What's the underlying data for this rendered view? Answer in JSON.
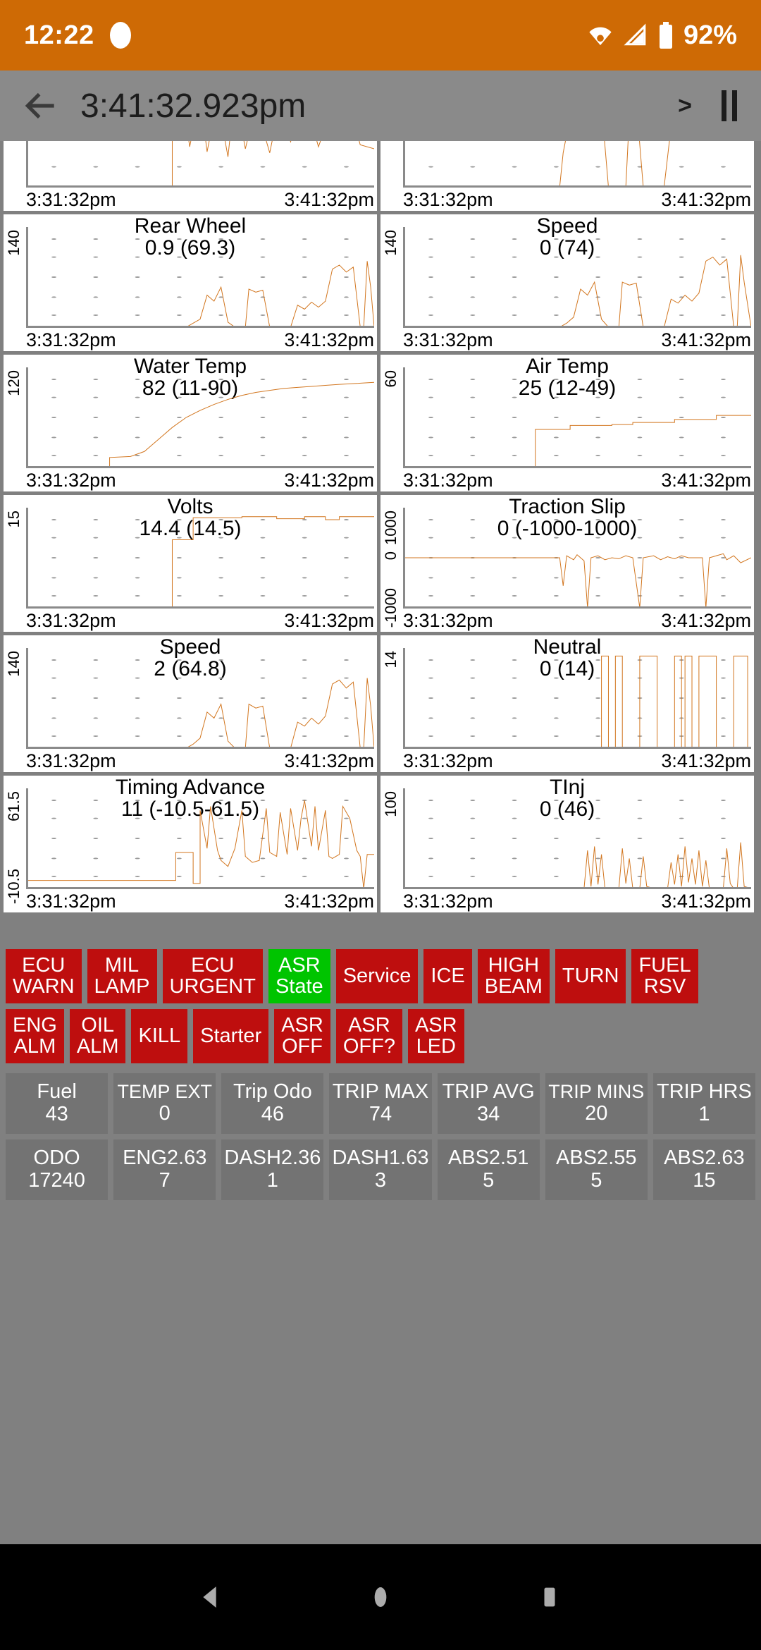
{
  "status_bar": {
    "clock": "12:22",
    "battery_percent": "92%",
    "icons": [
      "recording-dot-icon",
      "wifi-icon",
      "cell-signal-icon",
      "battery-icon"
    ]
  },
  "toolbar": {
    "back_icon": "back-arrow-icon",
    "title": "3:41:32.923pm",
    "next_label": ">",
    "pause_icon": "pause-icon"
  },
  "charts": {
    "x_start": "3:31:32pm",
    "x_end": "3:41:32pm",
    "line_color": "#D2761F"
  },
  "chart_data": [
    {
      "type": "line",
      "title": "",
      "value_label": "",
      "ylabel": "",
      "ytick_top": "",
      "xlabel_left": "3:31:32pm",
      "xlabel_right": "3:41:32pm",
      "note": "clipped row above Rear Wheel — spiky square-wave trace",
      "x": [
        0,
        34,
        36,
        40,
        44,
        48,
        52,
        56,
        60,
        64,
        68,
        72,
        76,
        80,
        84,
        88,
        92,
        96,
        100
      ],
      "values": [
        0,
        0,
        82,
        55,
        88,
        40,
        90,
        30,
        72,
        85,
        38,
        90,
        35,
        80,
        60,
        88,
        45,
        78,
        52
      ]
    },
    {
      "type": "line",
      "title": "Rear Wheel",
      "value_label": "0.9 (69.3)",
      "ylabel": "140",
      "ytick_top": "140",
      "ylim": [
        0,
        140
      ],
      "xlabel_left": "3:31:32pm",
      "xlabel_right": "3:41:32pm",
      "x": [
        0,
        48,
        52,
        55,
        58,
        60,
        63,
        66,
        69,
        72,
        74,
        78,
        82,
        86,
        90,
        94,
        97,
        100
      ],
      "values": [
        0,
        0,
        6,
        40,
        30,
        44,
        8,
        0,
        42,
        40,
        0,
        18,
        26,
        22,
        60,
        64,
        6,
        58
      ]
    },
    {
      "type": "line",
      "title": "Speed",
      "value_label": "0 (74)",
      "ylabel": "140",
      "ytick_top": "140",
      "ylim": [
        0,
        140
      ],
      "xlabel_left": "3:31:32pm",
      "xlabel_right": "3:41:32pm",
      "x": [
        0,
        47,
        51,
        54,
        57,
        60,
        63,
        66,
        69,
        72,
        76,
        80,
        84,
        88,
        92,
        96,
        100
      ],
      "values": [
        0,
        0,
        8,
        48,
        36,
        52,
        6,
        0,
        50,
        46,
        0,
        22,
        30,
        26,
        66,
        10,
        62
      ]
    },
    {
      "type": "line",
      "title": "Water Temp",
      "value_label": "82 (11-90)",
      "ylabel": "120",
      "ytick_top": "120",
      "ylim": [
        0,
        120
      ],
      "xlabel_left": "3:31:32pm",
      "xlabel_right": "3:41:32pm",
      "x": [
        0,
        24,
        25,
        30,
        36,
        42,
        48,
        54,
        60,
        66,
        72,
        78,
        84,
        90,
        95,
        100
      ],
      "values": [
        0,
        0,
        11,
        12,
        22,
        36,
        48,
        58,
        64,
        68,
        71,
        73,
        75,
        76,
        77,
        78
      ]
    },
    {
      "type": "line",
      "title": "Air Temp",
      "value_label": "25 (12-49)",
      "ylabel": "60",
      "ytick_top": "60",
      "ylim": [
        0,
        60
      ],
      "xlabel_left": "3:31:32pm",
      "xlabel_right": "3:41:32pm",
      "x": [
        0,
        38,
        39,
        46,
        54,
        62,
        70,
        78,
        86,
        94,
        100
      ],
      "values": [
        0,
        0,
        23,
        25,
        25,
        26,
        26,
        27,
        28,
        30,
        30
      ]
    },
    {
      "type": "line",
      "title": "Volts",
      "value_label": "14.4 (14.5)",
      "ylabel": "15",
      "ytick_top": "15",
      "ylim": [
        0,
        15
      ],
      "xlabel_left": "3:31:32pm",
      "xlabel_right": "3:41:32pm",
      "x": [
        0,
        42,
        43,
        48,
        55,
        62,
        70,
        78,
        86,
        94,
        100
      ],
      "values": [
        0,
        0,
        11.8,
        14.4,
        14.5,
        14.5,
        14.5,
        14.6,
        14.4,
        14.5,
        14.5
      ]
    },
    {
      "type": "line",
      "title": "Traction Slip",
      "value_label": "0 (-1000-1000)",
      "ylabel": "1000 / 0 / -1000",
      "ytick_top": "1000",
      "ytick_mid": "0",
      "ytick_low": "-1000",
      "ylim": [
        -1000,
        1000
      ],
      "xlabel_left": "3:31:32pm",
      "xlabel_right": "3:41:32pm",
      "x": [
        0,
        46,
        48,
        50,
        52,
        56,
        60,
        64,
        68,
        72,
        76,
        80,
        86,
        92,
        96,
        100
      ],
      "values": [
        0,
        0,
        -620,
        40,
        -900,
        30,
        -1000,
        20,
        -40,
        30,
        20,
        -30,
        -1000,
        60,
        -80,
        0
      ]
    },
    {
      "type": "line",
      "title": "Speed",
      "value_label": "2 (64.8)",
      "ylabel": "140",
      "ytick_top": "140",
      "ylim": [
        0,
        140
      ],
      "xlabel_left": "3:31:32pm",
      "xlabel_right": "3:41:32pm",
      "x": [
        0,
        48,
        52,
        55,
        58,
        61,
        64,
        67,
        70,
        73,
        78,
        82,
        86,
        90,
        94,
        97,
        100
      ],
      "values": [
        0,
        0,
        8,
        44,
        34,
        50,
        6,
        0,
        46,
        44,
        0,
        20,
        28,
        24,
        62,
        8,
        58
      ]
    },
    {
      "type": "line",
      "title": "Neutral",
      "value_label": "0 (14)",
      "ylabel": "14",
      "ytick_top": "14",
      "ylim": [
        0,
        14
      ],
      "xlabel_left": "3:31:32pm",
      "xlabel_right": "3:41:32pm",
      "x": [
        0,
        60,
        61,
        63,
        64,
        66,
        70,
        71,
        76,
        77,
        80,
        81,
        83,
        84,
        88,
        89,
        95,
        96,
        100
      ],
      "values": [
        0,
        0,
        14,
        14,
        0,
        0,
        14,
        0,
        14,
        0,
        14,
        0,
        14,
        0,
        14,
        0,
        14,
        0,
        0
      ]
    },
    {
      "type": "line",
      "title": "Timing Advance",
      "value_label": "11 (-10.5-61.5)",
      "ylabel": "61.5 / -10.5",
      "ytick_top": "61.5",
      "ytick_low": "-10.5",
      "ylim": [
        -10.5,
        61.5
      ],
      "xlabel_left": "3:31:32pm",
      "xlabel_right": "3:41:32pm",
      "x": [
        0,
        42,
        44,
        48,
        52,
        56,
        60,
        64,
        68,
        72,
        76,
        80,
        84,
        88,
        92,
        96,
        100
      ],
      "values": [
        -10.5,
        -10.5,
        5,
        55,
        2,
        58,
        -4,
        50,
        8,
        60,
        20,
        58,
        14,
        61.5,
        30,
        55,
        8
      ]
    },
    {
      "type": "line",
      "title": "TInj",
      "value_label": "0 (46)",
      "ylabel": "100",
      "ytick_top": "100",
      "ylim": [
        0,
        100
      ],
      "xlabel_left": "3:31:32pm",
      "xlabel_right": "3:41:32pm",
      "x": [
        0,
        50,
        52,
        54,
        56,
        58,
        62,
        64,
        68,
        72,
        76,
        80,
        84,
        88,
        92,
        96,
        100
      ],
      "values": [
        0,
        0,
        30,
        8,
        34,
        4,
        28,
        0,
        24,
        6,
        30,
        10,
        36,
        8,
        40,
        0,
        0
      ]
    }
  ],
  "status_buttons": {
    "rows": [
      [
        {
          "label": "ECU\nWARN",
          "state": "red"
        },
        {
          "label": "MIL\nLAMP",
          "state": "red"
        },
        {
          "label": "ECU\nURGENT",
          "state": "red"
        },
        {
          "label": "ASR\nState",
          "state": "green"
        },
        {
          "label": "Service",
          "state": "red"
        },
        {
          "label": "ICE",
          "state": "red"
        },
        {
          "label": "HIGH\nBEAM",
          "state": "red"
        },
        {
          "label": "TURN",
          "state": "red"
        },
        {
          "label": "FUEL\nRSV",
          "state": "red"
        }
      ],
      [
        {
          "label": "ENG\nALM",
          "state": "red"
        },
        {
          "label": "OIL\nALM",
          "state": "red"
        },
        {
          "label": "KILL",
          "state": "red"
        },
        {
          "label": "Starter",
          "state": "red"
        },
        {
          "label": "ASR\nOFF",
          "state": "red"
        },
        {
          "label": "ASR\nOFF?",
          "state": "red"
        },
        {
          "label": "ASR\nLED",
          "state": "red"
        }
      ]
    ],
    "colors": {
      "red": "#BE0E0E",
      "green": "#00C400"
    }
  },
  "data_grid": {
    "rows": [
      [
        {
          "label": "Fuel",
          "value": "43"
        },
        {
          "label": "TEMP EXT",
          "value": "0"
        },
        {
          "label": "Trip Odo",
          "value": "46"
        },
        {
          "label": "TRIP MAX",
          "value": "74"
        },
        {
          "label": "TRIP AVG",
          "value": "34"
        },
        {
          "label": "TRIP MINS",
          "value": "20"
        },
        {
          "label": "TRIP HRS",
          "value": "1"
        }
      ],
      [
        {
          "label": "ODO",
          "value": "17240"
        },
        {
          "label": "ENG2.63",
          "value": "7"
        },
        {
          "label": "DASH2.36",
          "value": "1"
        },
        {
          "label": "DASH1.63",
          "value": "3"
        },
        {
          "label": "ABS2.51",
          "value": "5"
        },
        {
          "label": "ABS2.55",
          "value": "5"
        },
        {
          "label": "ABS2.63",
          "value": "15"
        }
      ]
    ]
  },
  "nav_bar": {
    "back_icon": "nav-back-triangle-icon",
    "home_icon": "nav-home-circle-icon",
    "recents_icon": "nav-recents-square-icon"
  }
}
